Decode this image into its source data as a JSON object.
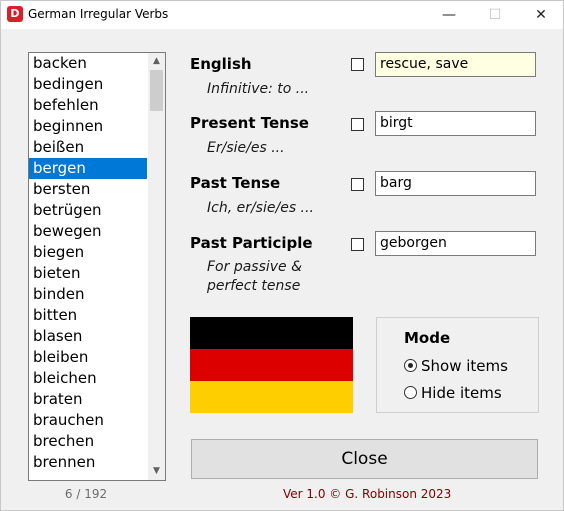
{
  "window": {
    "title": "German Irregular Verbs",
    "icon_letter": "D",
    "buttons": {
      "minimize": "—",
      "maximize": "☐",
      "close": "✕"
    }
  },
  "verb_list": {
    "items": [
      "backen",
      "bedingen",
      "befehlen",
      "beginnen",
      "beißen",
      "bergen",
      "bersten",
      "betrügen",
      "bewegen",
      "biegen",
      "bieten",
      "binden",
      "bitten",
      "blasen",
      "bleiben",
      "bleichen",
      "braten",
      "brauchen",
      "brechen",
      "brennen"
    ],
    "selected_index": 5,
    "counter": "6 / 192"
  },
  "fields": {
    "english": {
      "label": "English",
      "hint": "Infinitive: to ...",
      "value": "rescue, save",
      "checked": false
    },
    "present": {
      "label": "Present Tense",
      "hint": "Er/sie/es ...",
      "value": "birgt",
      "checked": false
    },
    "past": {
      "label": "Past Tense",
      "hint": "Ich, er/sie/es ...",
      "value": "barg",
      "checked": false
    },
    "participle": {
      "label": "Past Participle",
      "hint_line1": "For passive &",
      "hint_line2": "perfect tense",
      "value": "geborgen",
      "checked": false
    }
  },
  "flag": {
    "colors": [
      "#000000",
      "#dd0000",
      "#ffce00"
    ]
  },
  "mode": {
    "title": "Mode",
    "options": [
      {
        "label": "Show items",
        "checked": true
      },
      {
        "label": "Hide items",
        "checked": false
      }
    ]
  },
  "close_button": {
    "label": "Close"
  },
  "footer": {
    "text": "Ver 1.0  © G. Robinson 2023"
  }
}
